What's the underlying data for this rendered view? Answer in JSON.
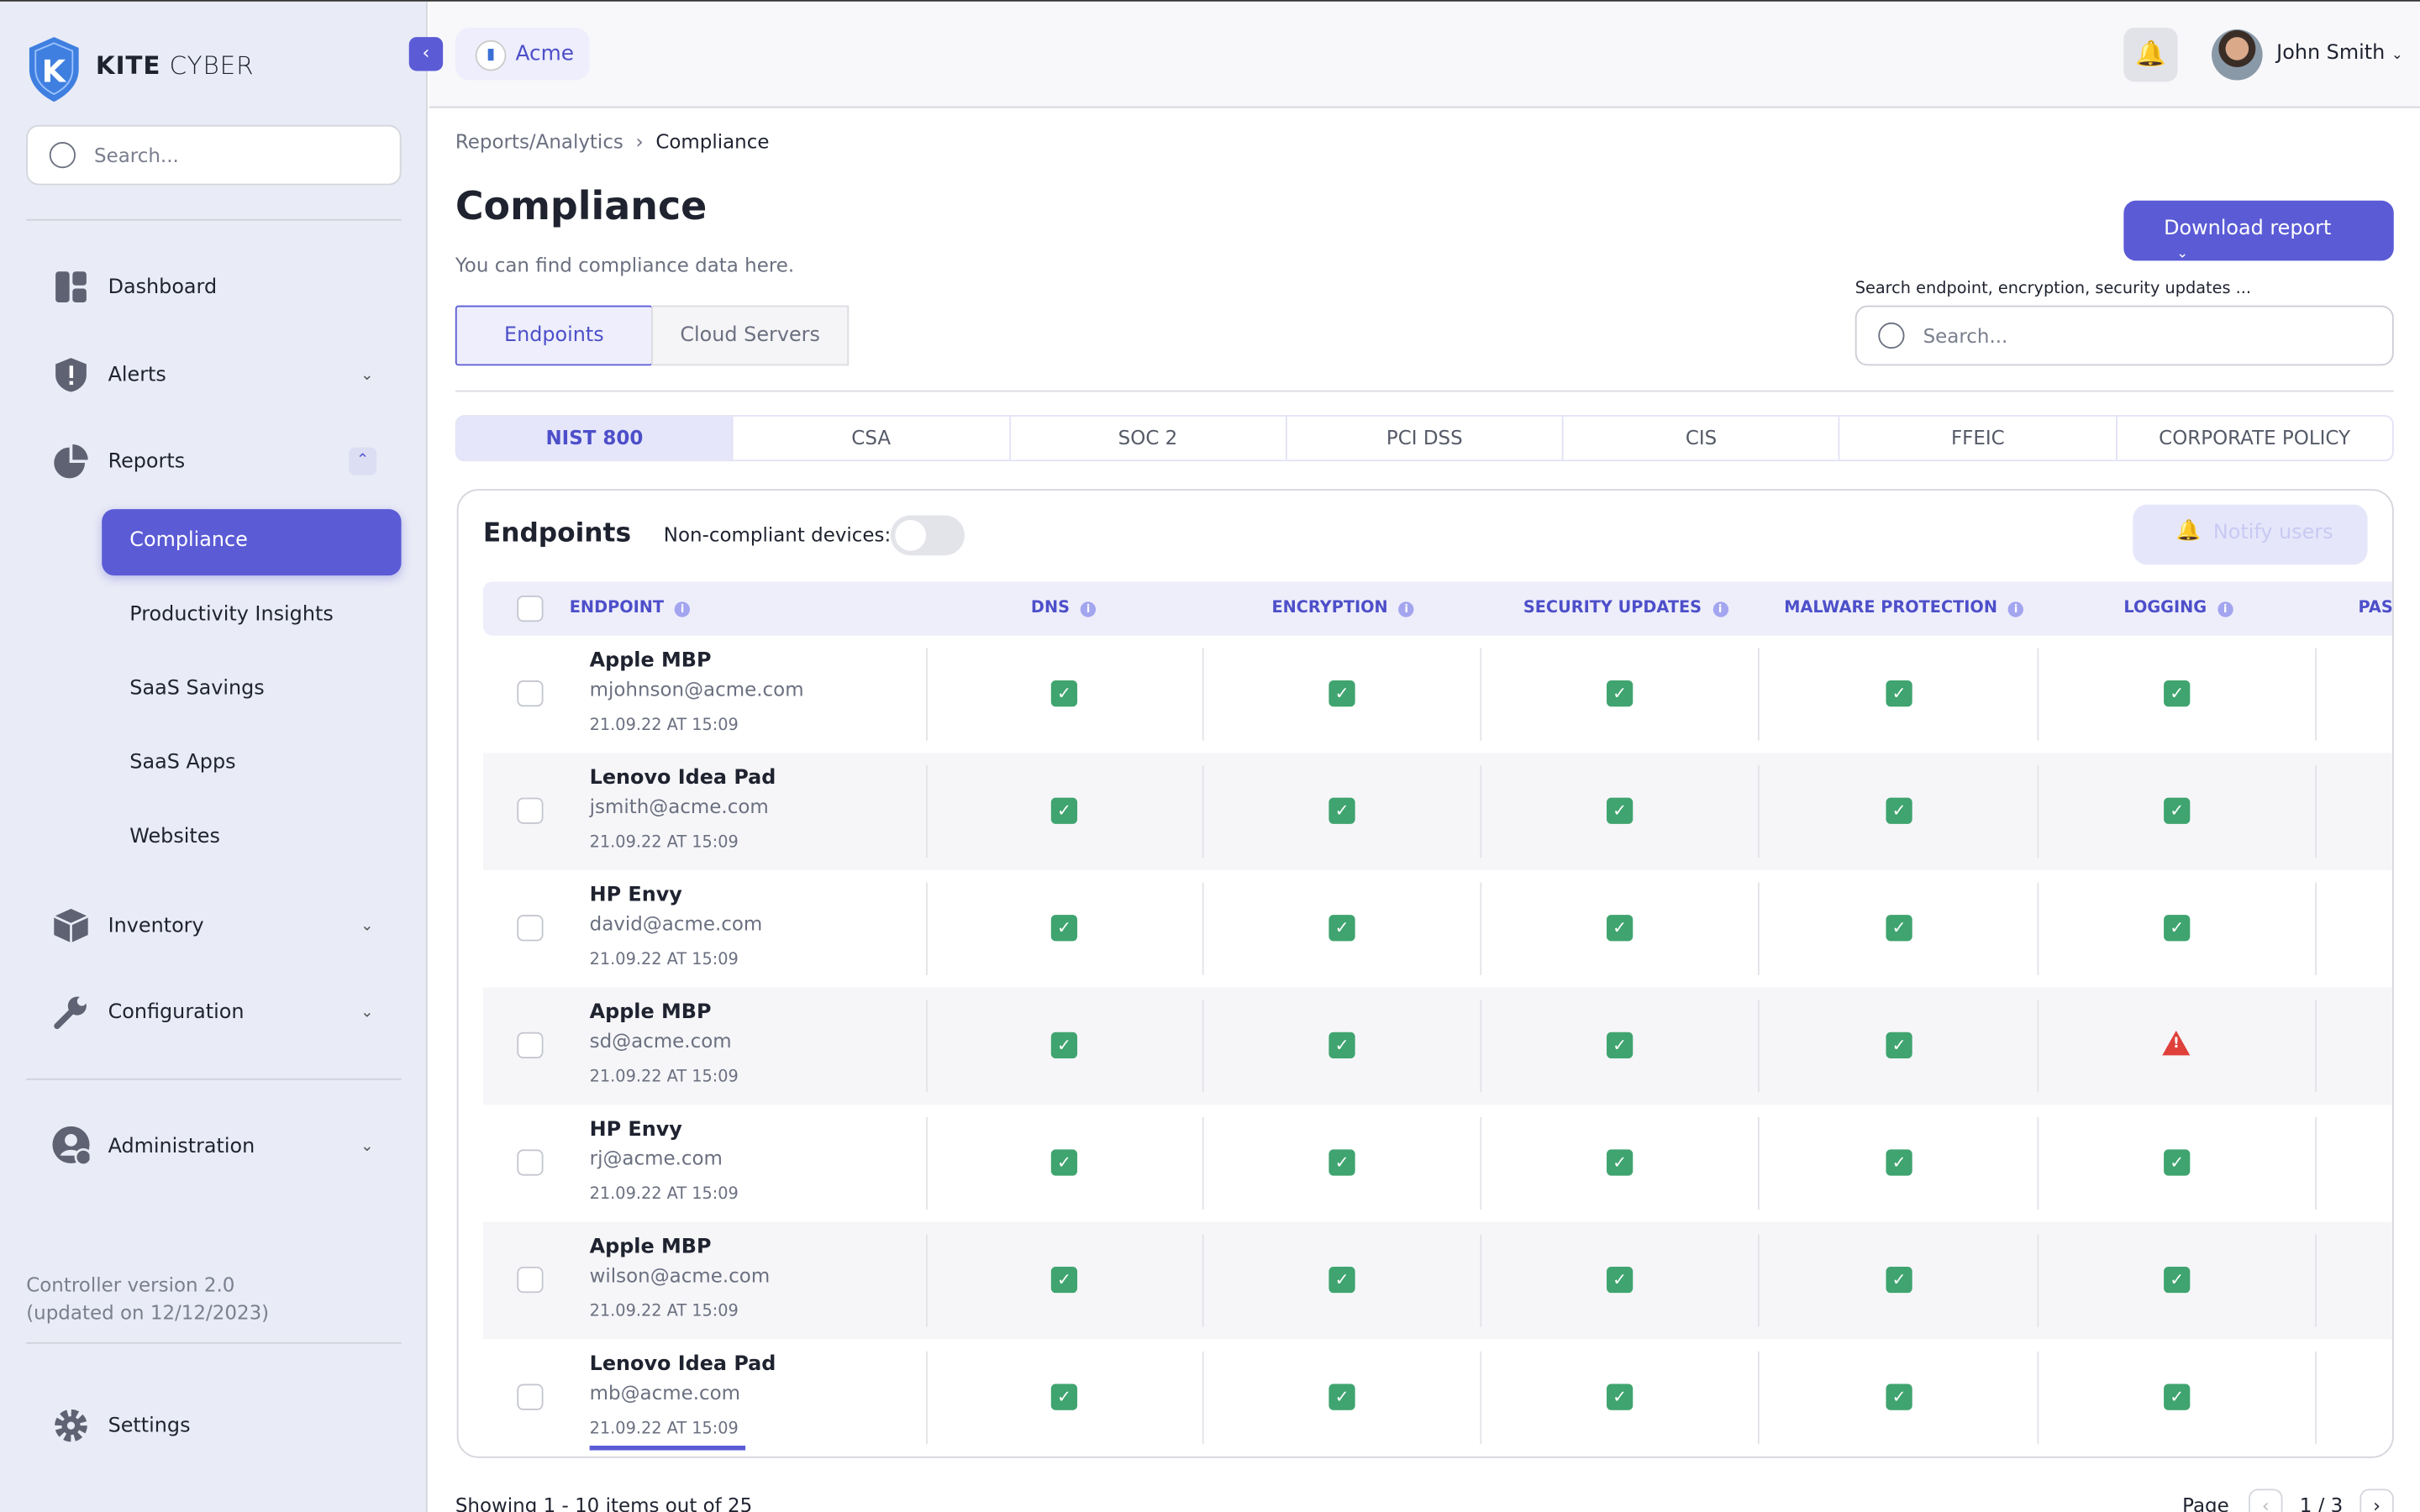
{
  "brand": {
    "name_bold": "KITE",
    "name_light": "CYBER"
  },
  "sidebar": {
    "search_placeholder": "Search...",
    "items": [
      {
        "label": "Dashboard",
        "icon": "dashboard-icon"
      },
      {
        "label": "Alerts",
        "icon": "shield-alert-icon"
      },
      {
        "label": "Reports",
        "icon": "pie-chart-icon"
      },
      {
        "label": "Inventory",
        "icon": "box-icon"
      },
      {
        "label": "Configuration",
        "icon": "wrench-icon"
      },
      {
        "label": "Administration",
        "icon": "user-gear-icon"
      }
    ],
    "report_subitems": [
      "Compliance",
      "Productivity Insights",
      "SaaS Savings",
      "SaaS Apps",
      "Websites"
    ],
    "active_subitem": "Compliance",
    "version": "Controller version 2.0",
    "version_updated": "(updated on 12/12/2023)",
    "settings": "Settings"
  },
  "topbar": {
    "org": "Acme",
    "user": "John Smith"
  },
  "breadcrumb": {
    "parent": "Reports/Analytics",
    "current": "Compliance"
  },
  "page": {
    "title": "Compliance",
    "subtitle": "You can find compliance data here.",
    "download": "Download report"
  },
  "tabs": [
    "Endpoints",
    "Cloud Servers"
  ],
  "active_tab": "Endpoints",
  "search": {
    "label": "Search endpoint, encryption, security updates  ...",
    "placeholder": "Search..."
  },
  "standards": [
    "NIST 800",
    "CSA",
    "SOC 2",
    "PCI DSS",
    "CIS",
    "FFEIC",
    "CORPORATE POLICY"
  ],
  "active_standard": "NIST 800",
  "card": {
    "title": "Endpoints",
    "noncompliant_label": "Non-compliant devices:",
    "noncompliant_toggle": false,
    "notify": "Notify users"
  },
  "columns": [
    "ENDPOINT",
    "DNS",
    "ENCRYPTION",
    "SECURITY UPDATES",
    "MALWARE PROTECTION",
    "LOGGING",
    "PAS"
  ],
  "rows": [
    {
      "name": "Apple MBP",
      "email": "mjohnson@acme.com",
      "date": "21.09.22 AT 15:09",
      "status": [
        "ok",
        "ok",
        "ok",
        "ok",
        "ok"
      ]
    },
    {
      "name": "Lenovo Idea Pad",
      "email": "jsmith@acme.com",
      "date": "21.09.22 AT 15:09",
      "status": [
        "ok",
        "ok",
        "ok",
        "ok",
        "ok"
      ]
    },
    {
      "name": "HP Envy",
      "email": "david@acme.com",
      "date": "21.09.22 AT 15:09",
      "status": [
        "ok",
        "ok",
        "ok",
        "ok",
        "ok"
      ]
    },
    {
      "name": "Apple MBP",
      "email": "sd@acme.com",
      "date": "21.09.22 AT 15:09",
      "status": [
        "ok",
        "ok",
        "ok",
        "ok",
        "warn"
      ]
    },
    {
      "name": "HP Envy",
      "email": "rj@acme.com",
      "date": "21.09.22 AT 15:09",
      "status": [
        "ok",
        "ok",
        "ok",
        "ok",
        "ok"
      ]
    },
    {
      "name": "Apple MBP",
      "email": "wilson@acme.com",
      "date": "21.09.22 AT 15:09",
      "status": [
        "ok",
        "ok",
        "ok",
        "ok",
        "ok"
      ]
    },
    {
      "name": "Lenovo Idea Pad",
      "email": "mb@acme.com",
      "date": "21.09.22 AT 15:09",
      "status": [
        "ok",
        "ok",
        "ok",
        "ok",
        "ok"
      ]
    }
  ],
  "footer": {
    "showing": "Showing 1 - 10 items out of 25",
    "page_label": "Page",
    "page": "1 / 3"
  },
  "colors": {
    "accent": "#5b5bd6",
    "ok": "#3fa46f",
    "warn": "#e0403a",
    "sidebar_bg": "#e9ebf6"
  }
}
